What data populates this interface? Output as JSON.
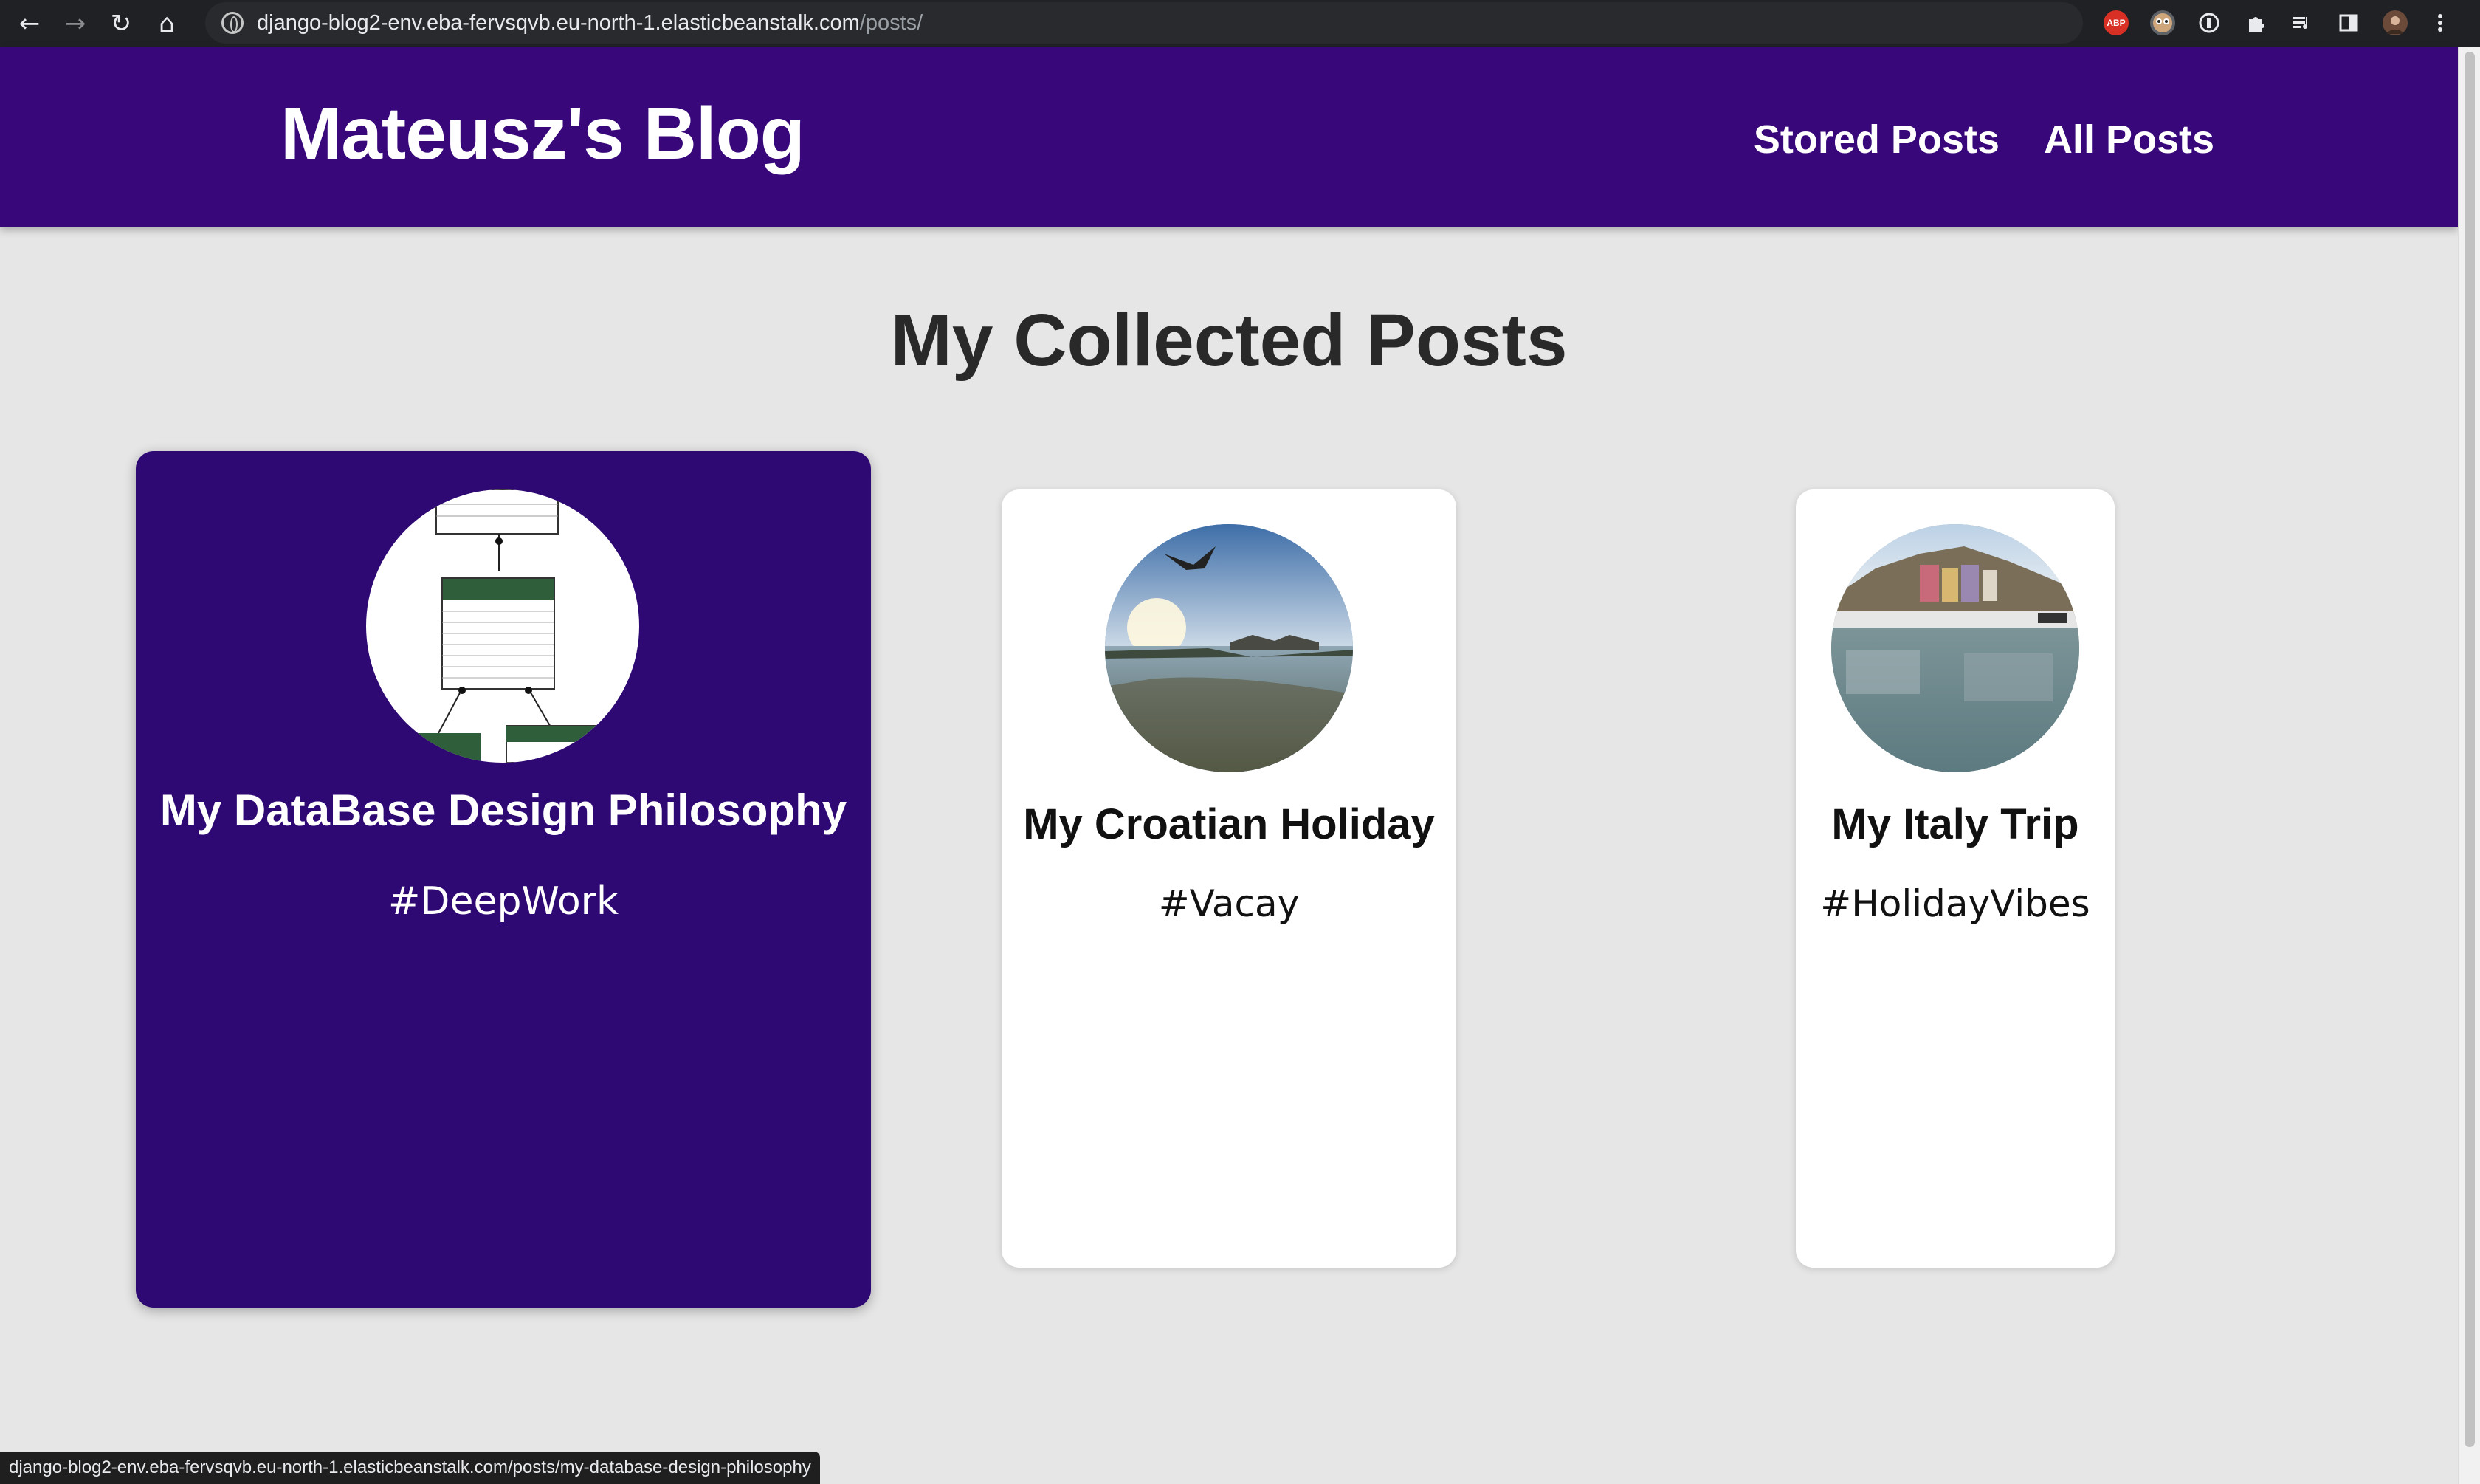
{
  "browser": {
    "back_icon": "←",
    "forward_icon": "→",
    "reload_icon": "↻",
    "home_icon": "⌂",
    "url_host": "django-blog2-env.eba-fervsqvb.eu-north-1.elasticbeanstalk.com",
    "url_path": "/posts/",
    "extensions": [
      "ABP",
      "",
      "",
      "",
      "",
      "",
      ""
    ],
    "status_url": "django-blog2-env.eba-fervsqvb.eu-north-1.elasticbeanstalk.com/posts/my-database-design-philosophy"
  },
  "header": {
    "logo": "Mateusz's Blog",
    "nav": [
      {
        "label": "Stored Posts"
      },
      {
        "label": "All Posts"
      }
    ]
  },
  "main": {
    "title": "My Collected Posts",
    "posts": [
      {
        "title": "My DataBase Design Philosophy",
        "tag": "#DeepWork"
      },
      {
        "title": "My Croatian Holiday",
        "tag": "#Vacay"
      },
      {
        "title": "My Italy Trip",
        "tag": "#HolidayVibes"
      }
    ]
  },
  "colors": {
    "header_bg": "#38087a",
    "active_card_bg": "#2e0873",
    "page_bg": "#e6e6e6"
  }
}
